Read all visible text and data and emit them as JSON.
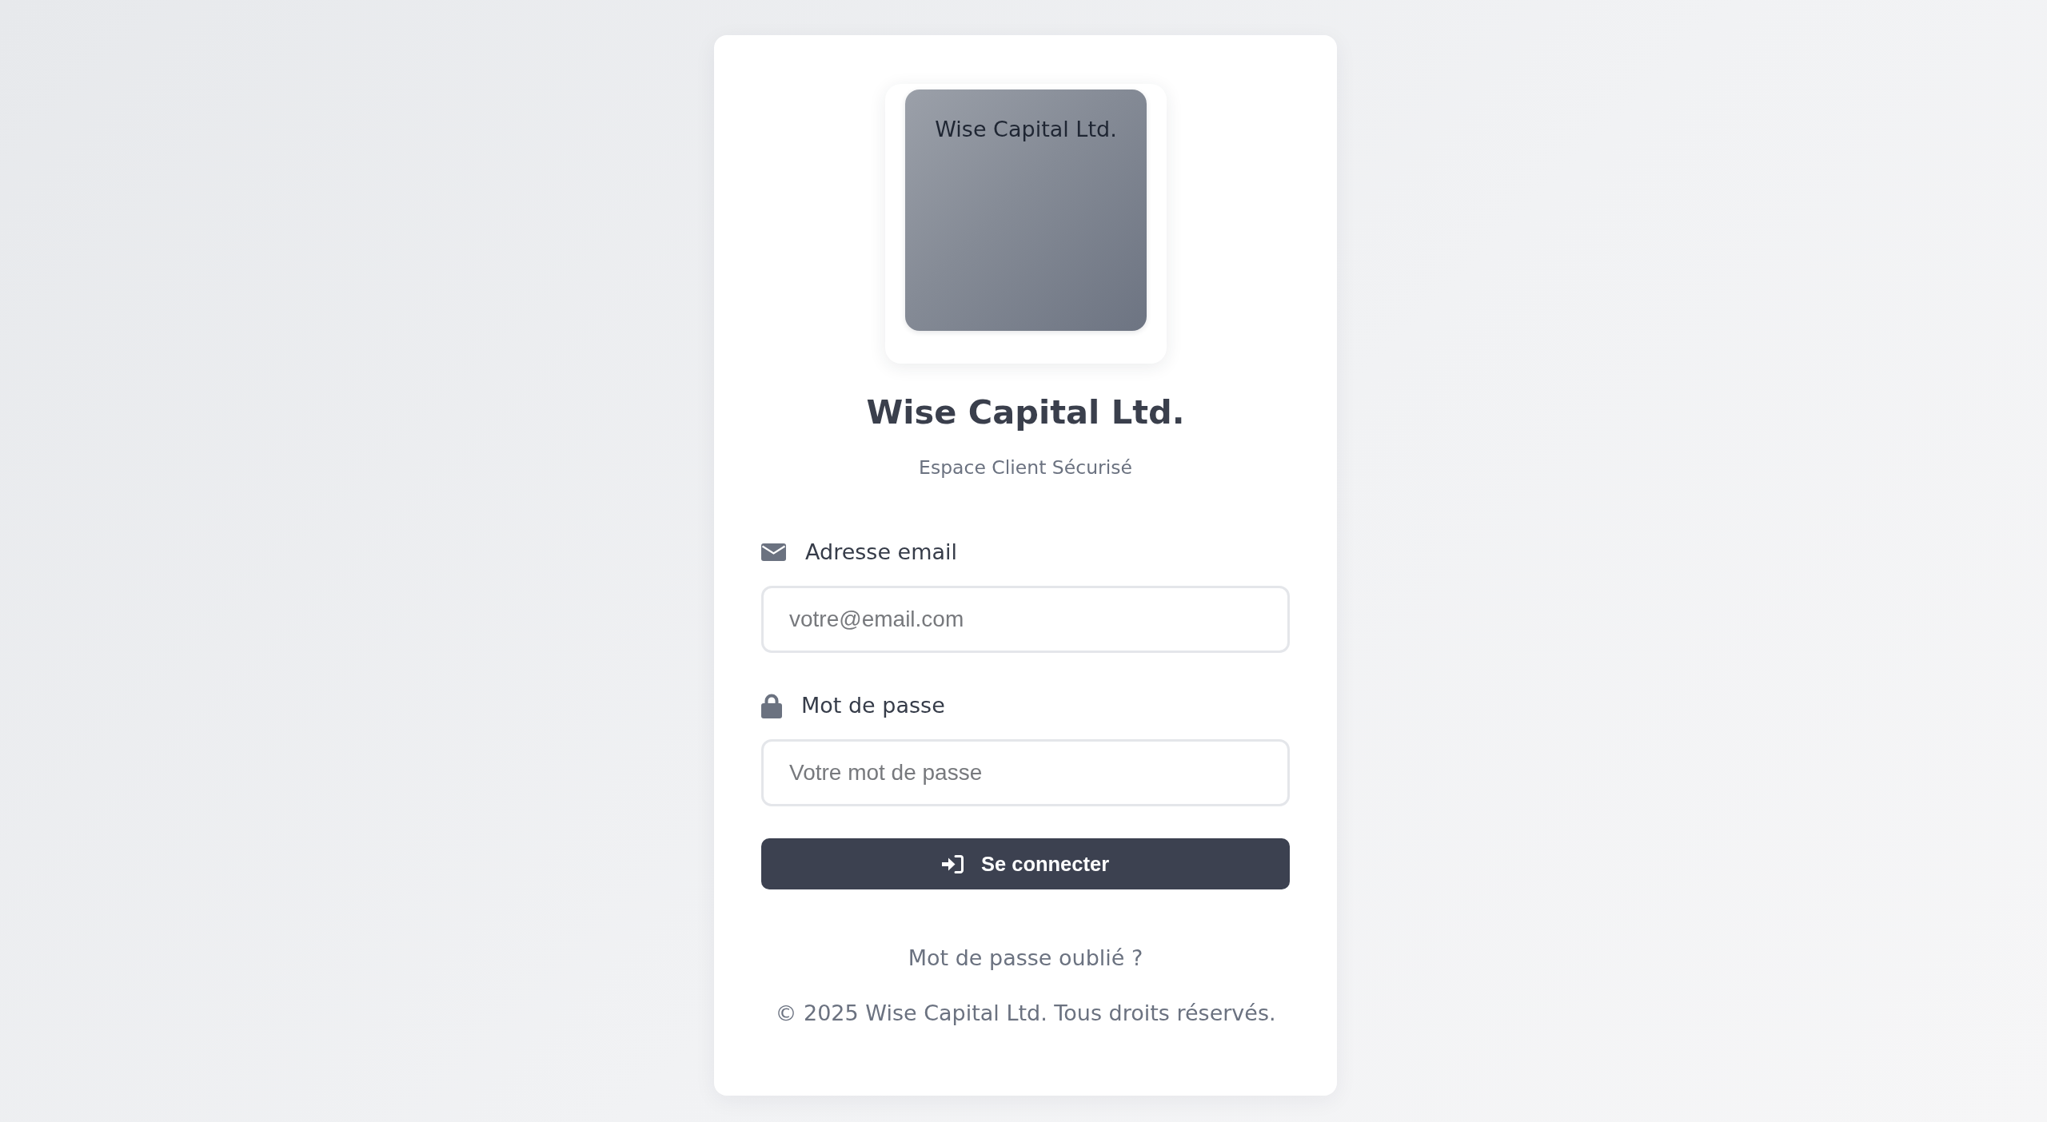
{
  "logo": {
    "text": "Wise Capital Ltd."
  },
  "title": "Wise Capital Ltd.",
  "subtitle": "Espace Client Sécurisé",
  "fields": [
    {
      "kind": "email",
      "label": "Adresse email",
      "placeholder": "votre@email.com"
    },
    {
      "kind": "password",
      "label": "Mot de passe",
      "placeholder": "Votre mot de passe"
    }
  ],
  "submit_button": {
    "label": "Se connecter"
  },
  "forgot_link": "Mot de passe oublié ?",
  "footer": "© 2025 Wise Capital Ltd. Tous droits réservés."
}
